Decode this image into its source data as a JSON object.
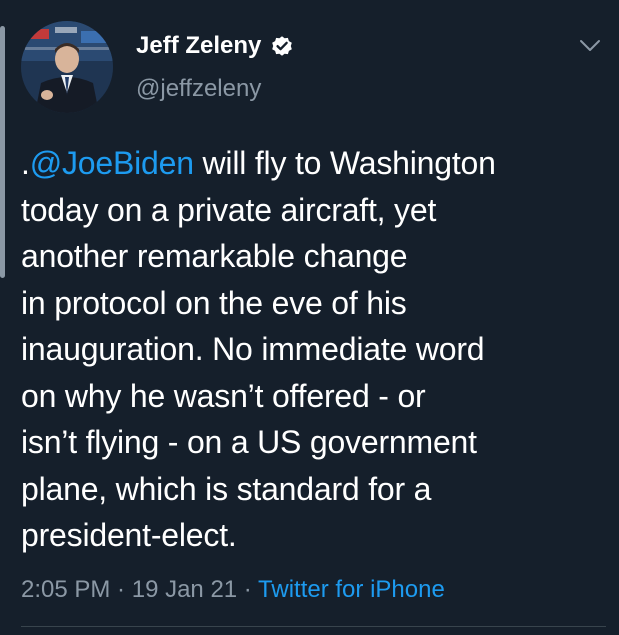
{
  "author": {
    "display_name": "Jeff Zeleny",
    "handle": "@jeffzeleny",
    "verified": true
  },
  "tweet": {
    "line1_prefix": ".",
    "mention": "@JoeBiden",
    "line1_suffix": " will fly to Washington",
    "lines": [
      "today on a private aircraft, yet",
      "another remarkable change",
      "in protocol on the eve of his",
      "inauguration. No immediate word",
      "on why he wasn’t offered - or",
      "isn’t flying - on a US government",
      "plane, which is standard for a",
      "president-elect."
    ]
  },
  "meta": {
    "time": "2:05 PM",
    "separator": " · ",
    "date": "19 Jan 21",
    "source": "Twitter for iPhone"
  },
  "icons": {
    "verified": "verified-badge-icon",
    "menu": "chevron-down-icon"
  },
  "colors": {
    "background": "#151f2b",
    "text": "#ffffff",
    "secondary": "#8b98a5",
    "link": "#1d9bf0"
  }
}
